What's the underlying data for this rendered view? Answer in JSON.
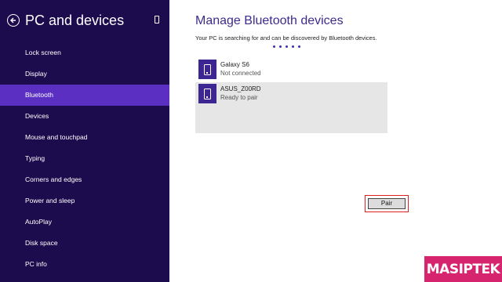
{
  "sidebar": {
    "title": "PC and devices",
    "items": [
      {
        "label": "Lock screen"
      },
      {
        "label": "Display"
      },
      {
        "label": "Bluetooth",
        "active": true
      },
      {
        "label": "Devices"
      },
      {
        "label": "Mouse and touchpad"
      },
      {
        "label": "Typing"
      },
      {
        "label": "Corners and edges"
      },
      {
        "label": "Power and sleep"
      },
      {
        "label": "AutoPlay"
      },
      {
        "label": "Disk space"
      },
      {
        "label": "PC info"
      }
    ]
  },
  "main": {
    "title": "Manage Bluetooth devices",
    "search_text": "Your PC is searching for and can be discovered by Bluetooth devices.",
    "devices": [
      {
        "name": "Galaxy S6",
        "status": "Not connected"
      },
      {
        "name": "ASUS_Z00RD",
        "status": "Ready to pair",
        "selected": true
      }
    ],
    "pair_label": "Pair"
  },
  "watermark": {
    "text": "MASIPTEK"
  },
  "colors": {
    "sidebar_bg": "#1d0c4d",
    "sidebar_active": "#5b2fc1",
    "accent": "#3d2592",
    "highlight": "#e02020",
    "watermark_bg": "#d6246e"
  },
  "icons": {
    "back": "back-arrow-icon",
    "device_small": "device-icon",
    "device_tile": "phone-icon"
  }
}
